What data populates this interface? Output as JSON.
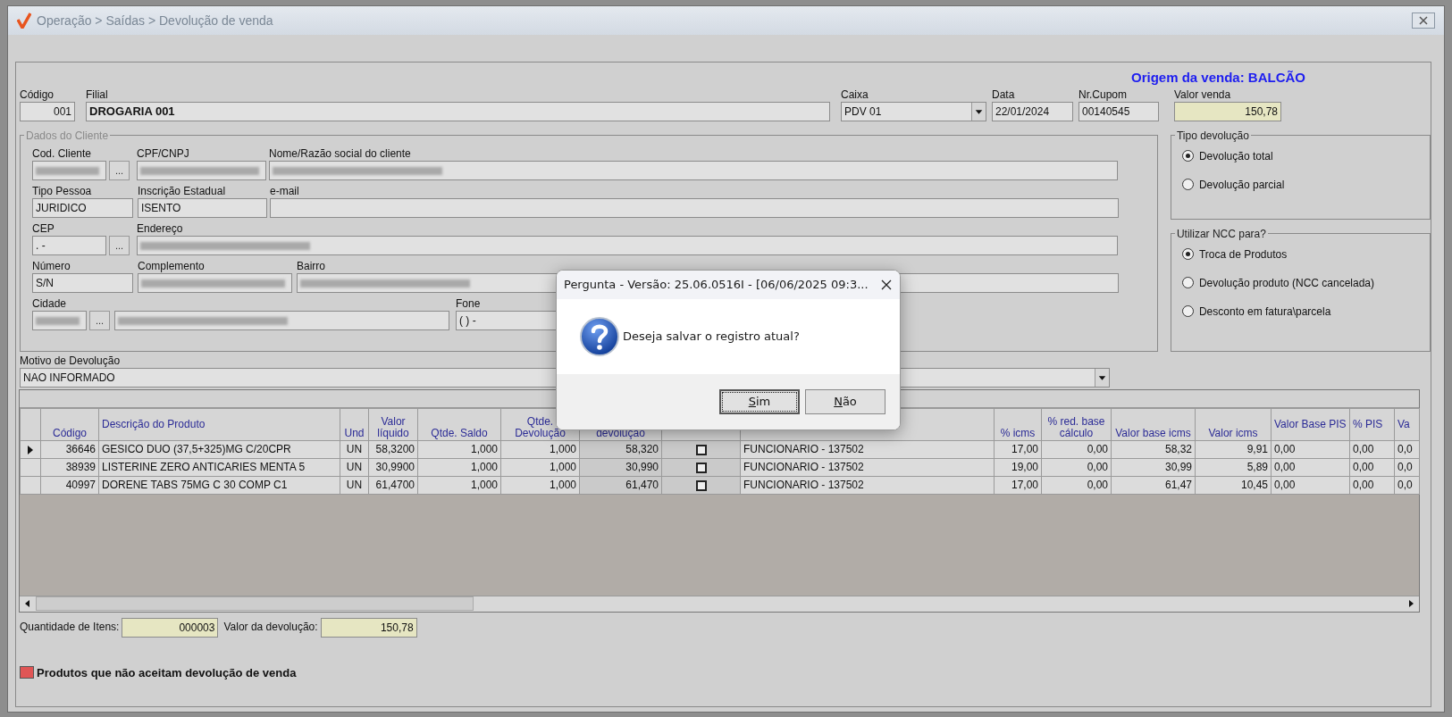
{
  "window": {
    "title": "Operação > Saídas > Devolução de venda"
  },
  "origin_label": "Origem da venda: BALCÃO",
  "header_fields": [
    {
      "label": "Código",
      "value": "001",
      "kind": "number"
    },
    {
      "label": "Filial",
      "value": "DROGARIA 001",
      "kind": "bold"
    },
    {
      "label": "Caixa",
      "value": "PDV 01",
      "kind": "dropdown"
    },
    {
      "label": "Data",
      "value": "22/01/2024",
      "kind": "text"
    },
    {
      "label": "Nr.Cupom",
      "value": "00140545",
      "kind": "text"
    },
    {
      "label": "Valor venda",
      "value": "150,78",
      "kind": "total"
    }
  ],
  "client_group": {
    "title": "Dados do Cliente",
    "rows": [
      [
        {
          "label": "Cod. Cliente",
          "redacted": true,
          "lookup_button": "..."
        },
        {
          "label": "CPF/CNPJ",
          "redacted": true
        },
        {
          "label": "Nome/Razão social do cliente",
          "redacted": true
        }
      ],
      [
        {
          "label": "Tipo Pessoa",
          "value": "JURIDICO",
          "redacted": false
        },
        {
          "label": "Inscrição Estadual",
          "value": "ISENTO",
          "redacted": false
        },
        {
          "label": "e-mail",
          "redacted": false
        }
      ],
      [
        {
          "label": "CEP",
          "value": ". -",
          "redacted": false,
          "lookup_button": "..."
        },
        {
          "label": "Endereço",
          "redacted": true
        }
      ],
      [
        {
          "label": "Número",
          "value": "S/N",
          "redacted": false
        },
        {
          "label": "Complemento",
          "redacted": true
        },
        {
          "label": "Bairro",
          "redacted": true
        }
      ],
      [
        {
          "label": "Cidade",
          "redacted": true,
          "lookup_button": "..."
        },
        {
          "redacted": true
        },
        {
          "label": "Fone",
          "value": "( ) -",
          "redacted": false
        }
      ]
    ]
  },
  "return_type": {
    "title": "Tipo devolução",
    "options": [
      {
        "label": "Devolução total",
        "selected": true
      },
      {
        "label": "Devolução parcial",
        "selected": false
      }
    ]
  },
  "ncc_use": {
    "title": "Utilizar NCC para?",
    "options": [
      {
        "label": "Troca de Produtos",
        "selected": true
      },
      {
        "label": "Devolução produto (NCC cancelada)",
        "selected": false
      },
      {
        "label": "Desconto em fatura\\parcela",
        "selected": false
      }
    ]
  },
  "reason": {
    "label": "Motivo de Devolução",
    "value": "NAO INFORMADO"
  },
  "grid": {
    "columns": [
      {
        "kind": "indicator"
      },
      {
        "label": "Código",
        "kind": "number"
      },
      {
        "label": "Descrição do Produto",
        "kind": "text"
      },
      {
        "label": "Und",
        "kind": "center"
      },
      {
        "label": "Valor líquido",
        "kind": "number"
      },
      {
        "label": "Qtde. Saldo",
        "kind": "number"
      },
      {
        "label": "Qtde. Devolução",
        "kind": "number"
      },
      {
        "label": "devolução",
        "kind": "number"
      },
      {
        "kind": "checkbox"
      },
      {
        "kind": "text"
      },
      {
        "label": "% icms",
        "kind": "number"
      },
      {
        "label": "% red. base cálculo",
        "kind": "number"
      },
      {
        "label": "Valor base icms",
        "kind": "number"
      },
      {
        "label": "Valor icms",
        "kind": "number"
      },
      {
        "label": "Valor Base PIS",
        "kind": "text"
      },
      {
        "label": "% PIS",
        "kind": "text"
      },
      {
        "label": "Va",
        "kind": "text"
      }
    ],
    "rows": [
      {
        "selected": true,
        "checked": false,
        "cells": [
          "",
          "36646",
          "GESICO DUO (37,5+325)MG C/20CPR",
          "UN",
          "58,3200",
          "1,000",
          "1,000",
          "58,320",
          "",
          "FUNCIONARIO - 137502",
          "17,00",
          "0,00",
          "58,32",
          "9,91",
          "0,00",
          "0,00",
          "0,0"
        ]
      },
      {
        "selected": false,
        "checked": false,
        "cells": [
          "",
          "38939",
          "LISTERINE ZERO ANTICARIES MENTA 5",
          "UN",
          "30,9900",
          "1,000",
          "1,000",
          "30,990",
          "",
          "FUNCIONARIO - 137502",
          "19,00",
          "0,00",
          "30,99",
          "5,89",
          "0,00",
          "0,00",
          "0,0"
        ]
      },
      {
        "selected": false,
        "checked": false,
        "cells": [
          "",
          "40997",
          "DORENE TABS 75MG C 30 COMP C1",
          "UN",
          "61,4700",
          "1,000",
          "1,000",
          "61,470",
          "",
          "FUNCIONARIO - 137502",
          "17,00",
          "0,00",
          "61,47",
          "10,45",
          "0,00",
          "0,00",
          "0,0"
        ]
      }
    ]
  },
  "totals": {
    "items_label": "Quantidade de Itens:",
    "items_value": "000003",
    "return_label": "Valor da devolução:",
    "return_value": "150,78"
  },
  "legend": {
    "color": "#e05555",
    "label": "Produtos que não aceitam devolução de venda"
  },
  "dialog": {
    "title": "Pergunta - Versão: 25.06.0516I - [06/06/2025 09:3...",
    "message": "Deseja salvar o registro atual?",
    "buttons": [
      {
        "label": "Sim",
        "focused": true
      },
      {
        "label": "Não",
        "focused": false
      }
    ]
  }
}
